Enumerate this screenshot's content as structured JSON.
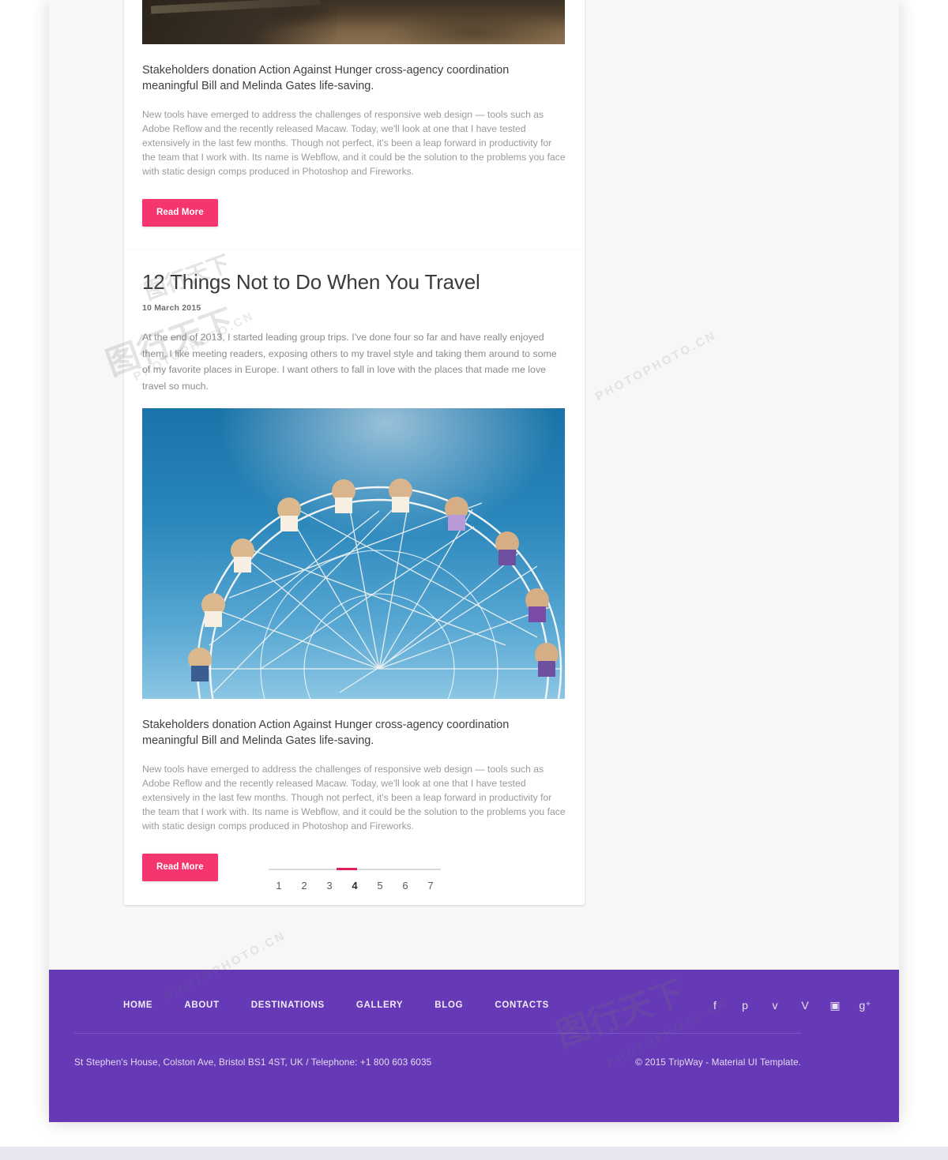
{
  "site": {
    "accent_pink": "#f5356e",
    "footer_purple": "#6639b6",
    "page_background": "#f7f7f7",
    "active_page_bar": "#e0215b"
  },
  "posts": [
    {
      "image_name": "beach-sand-photo",
      "heading": "Stakeholders donation Action Against Hunger cross-agency coordination meaningful Bill and Melinda Gates life-saving.",
      "body": "New tools have emerged to address the challenges of responsive web design — tools such as Adobe Reflow and the recently released Macaw. Today, we'll look at one that I have tested extensively in the last few months. Though not perfect, it's been a leap forward in productivity for the team that I work with. Its name is Webflow, and it could be the solution to the problems you face with static design comps produced in Photoshop and Fireworks.",
      "read_more_label": "Read More"
    },
    {
      "title": "12 Things Not to Do When You Travel",
      "date": "10 March 2015",
      "lead": "At the end of 2013, I started leading group trips. I've done four so far and have really enjoyed them. I like meeting readers, exposing others to my travel style and taking them around to some of my favorite places in Europe. I want others to fall in love with the places that made me love travel so much.",
      "image_name": "ferris-wheel-photo",
      "heading": "Stakeholders donation Action Against Hunger cross-agency coordination meaningful Bill and Melinda Gates life-saving.",
      "body": "New tools have emerged to address the challenges of responsive web design — tools such as Adobe Reflow and the recently released Macaw. Today, we'll look at one that I have tested extensively in the last few months. Though not perfect, it's been a leap forward in productivity for the team that I work with. Its name is Webflow, and it could be the solution to the problems you face with static design comps produced in Photoshop and Fireworks.",
      "read_more_label": "Read More"
    }
  ],
  "pagination": {
    "pages": [
      "1",
      "2",
      "3",
      "4",
      "5",
      "6",
      "7"
    ],
    "active": "4"
  },
  "footer": {
    "nav": [
      {
        "label": "HOME"
      },
      {
        "label": "ABOUT"
      },
      {
        "label": "DESTINATIONS"
      },
      {
        "label": "GALLERY"
      },
      {
        "label": "BLOG"
      },
      {
        "label": "CONTACTS"
      }
    ],
    "social": [
      {
        "name": "facebook-icon",
        "glyph": "f"
      },
      {
        "name": "pinterest-icon",
        "glyph": "p"
      },
      {
        "name": "twitter-icon",
        "glyph": "ᴠ"
      },
      {
        "name": "vimeo-icon",
        "glyph": "V"
      },
      {
        "name": "instagram-icon",
        "glyph": "▣"
      },
      {
        "name": "google-plus-icon",
        "glyph": "g⁺"
      }
    ],
    "address": "St Stephen's House, Colston Ave, Bristol BS1 4ST, UK  /  Telephone: +1 800 603 6035",
    "copyright": "© 2015 TripWay - Material UI Template."
  },
  "watermarks": {
    "latin": "PHOTOPHOTO.CN",
    "cn": "图行天下"
  }
}
